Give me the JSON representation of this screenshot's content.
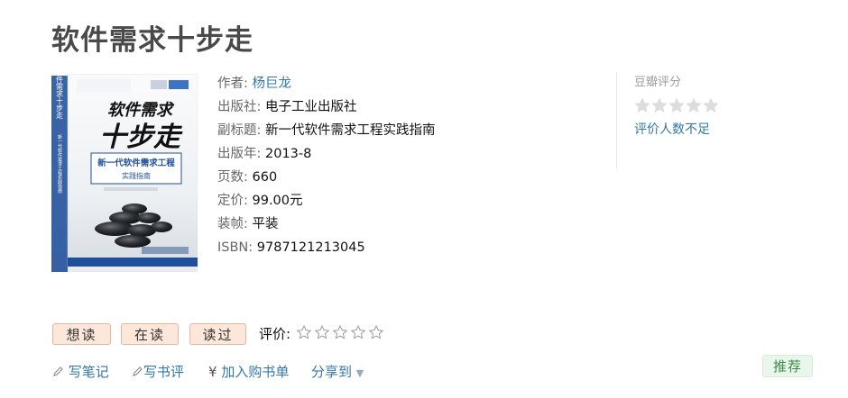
{
  "book": {
    "title": "软件需求十步走",
    "cover": {
      "title_line1": "软件需求",
      "title_line2": "十步走",
      "subtitle_line1": "新一代软件需求工程",
      "subtitle_line2": "实践指南"
    }
  },
  "info": {
    "author_label": "作者:",
    "author_value": "杨巨龙",
    "publisher_label": "出版社:",
    "publisher_value": "电子工业出版社",
    "subtitle_label": "副标题:",
    "subtitle_value": "新一代软件需求工程实践指南",
    "year_label": "出版年:",
    "year_value": "2013-8",
    "pages_label": "页数:",
    "pages_value": "660",
    "price_label": "定价:",
    "price_value": "99.00元",
    "binding_label": "装帧:",
    "binding_value": "平装",
    "isbn_label": "ISBN:",
    "isbn_value": "9787121213045"
  },
  "rating": {
    "title": "豆瓣评分",
    "note": "评价人数不足",
    "stars_filled": 0,
    "stars_total": 5
  },
  "user_actions": {
    "want": "想读",
    "doing": "在读",
    "done": "读过",
    "rate_label": "评价:",
    "rate_stars_total": 5
  },
  "links": {
    "note": "写笔记",
    "review": "写书评",
    "cart": "加入购书单",
    "share": "分享到",
    "cart_symbol": "¥"
  },
  "recommend": "推荐",
  "colors": {
    "link": "#3377aa",
    "button_bg": "#fde7da",
    "button_border": "#e2b89f",
    "star_empty": "#dddddd",
    "recommend_bg": "#e9f6eb",
    "recommend_text": "#3e8a4a"
  }
}
